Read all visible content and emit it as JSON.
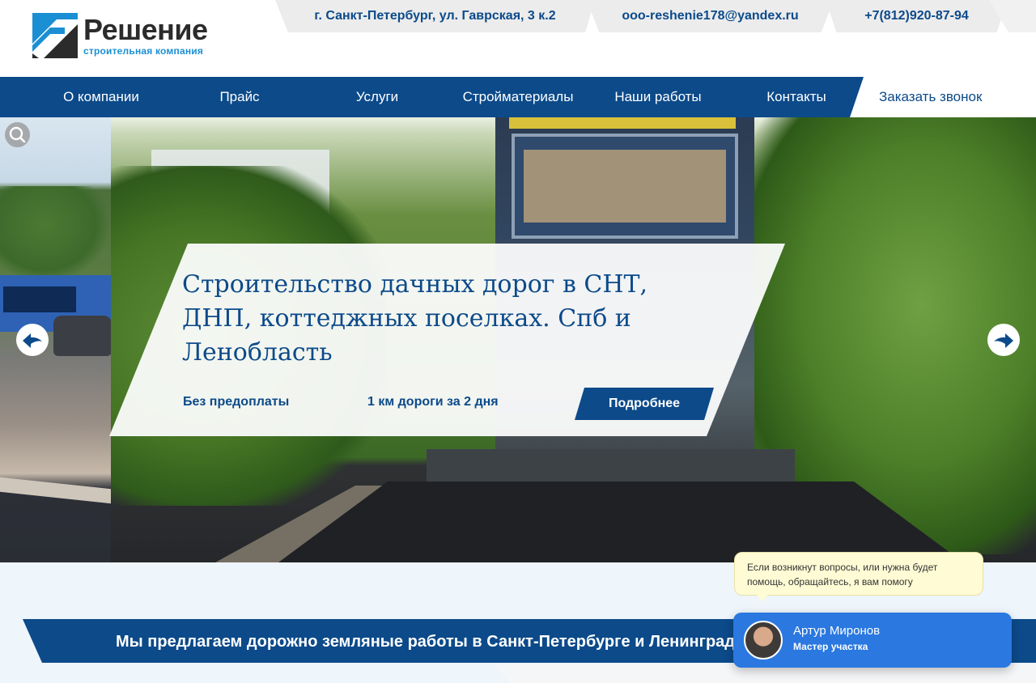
{
  "header": {
    "logo_name": "Решение",
    "logo_sub": "строительная компания",
    "address": "г. Санкт-Петербург, ул. Гаврская, 3 к.2",
    "email": "ooo-reshenie178@yandex.ru",
    "phone": "+7(812)920-87-94"
  },
  "nav": {
    "items": [
      {
        "label": "О компании"
      },
      {
        "label": "Прайс"
      },
      {
        "label": "Услуги"
      },
      {
        "label": "Стройматериалы"
      },
      {
        "label": "Наши работы"
      },
      {
        "label": "Контакты"
      }
    ],
    "callback_label": "Заказать звонок"
  },
  "hero": {
    "title": "Строительство дачных дорог в СНТ, ДНП, коттеджных поселках. Спб и Ленобласть",
    "feature_1": "Без предоплаты",
    "feature_2": "1 км дороги за 2 дня",
    "button_label": "Подробнее"
  },
  "offer": {
    "text": "Мы предлагаем дорожно земляные работы в Санкт-Петербурге и Ленинградской области"
  },
  "chat": {
    "message": "Если возникнут вопросы, или нужна будет помощь, обращайтесь, я вам помогу",
    "name": "Артур Миронов",
    "role": "Мастер участка"
  },
  "colors": {
    "brand_blue": "#0c4a8a",
    "accent_blue": "#1b8fd4",
    "chat_blue": "#2a78e0"
  },
  "icons": [
    "logo-mark",
    "search-icon",
    "arrow-left-icon",
    "arrow-right-icon",
    "avatar"
  ]
}
